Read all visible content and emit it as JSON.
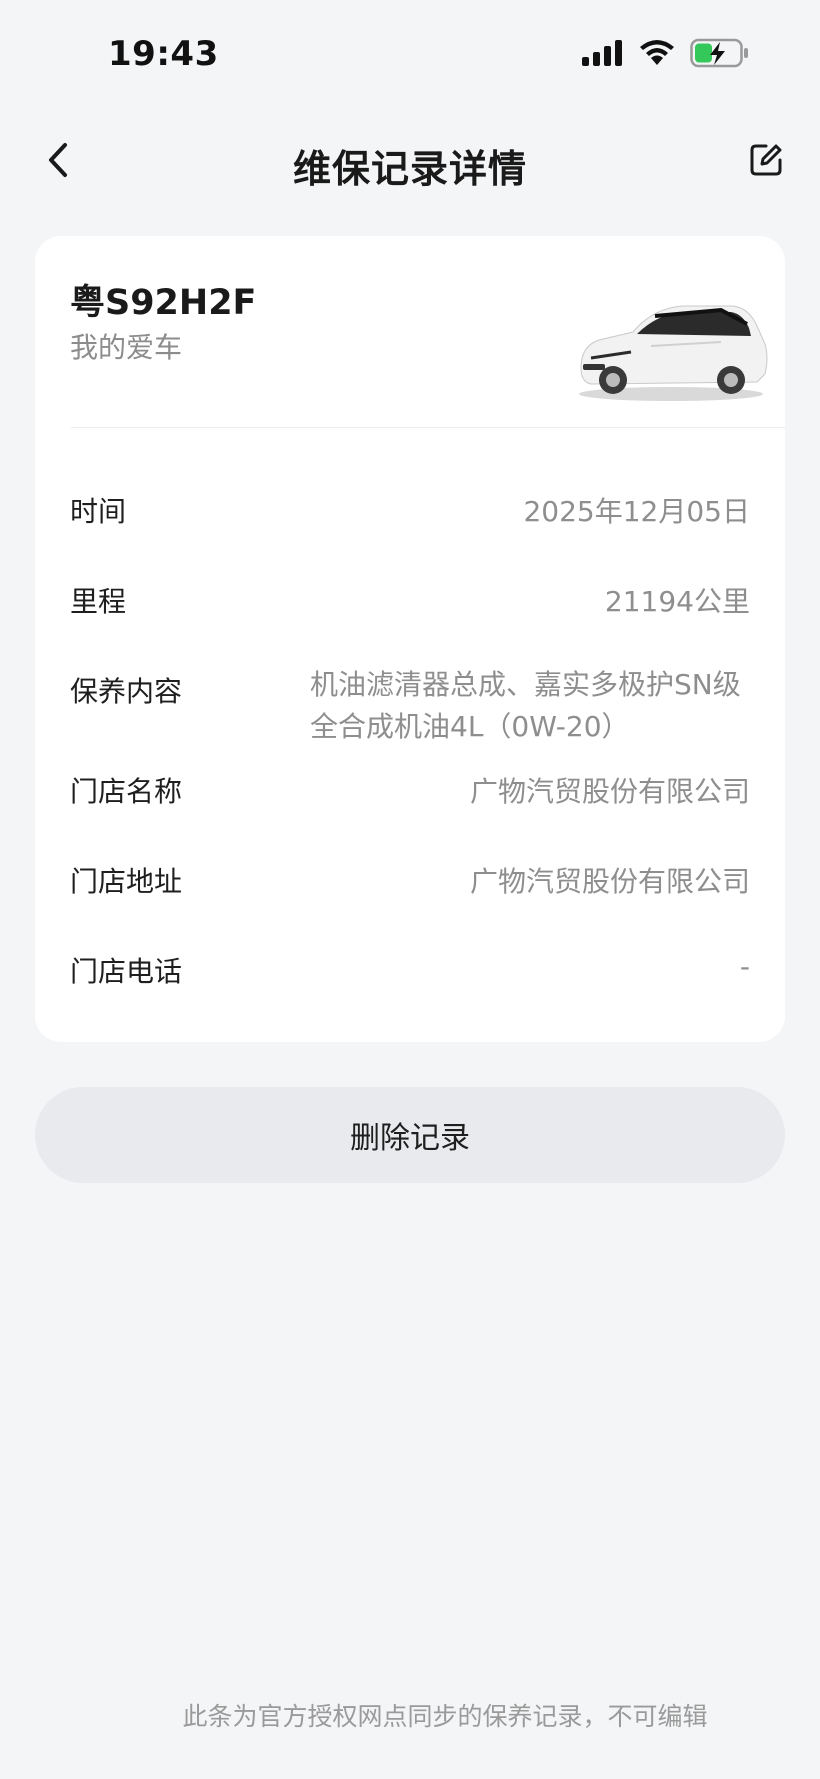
{
  "status_bar": {
    "time": "19:43",
    "icons": [
      "signal-icon",
      "wifi-icon",
      "battery-charging-icon"
    ],
    "battery_color": "#34c759"
  },
  "header": {
    "title": "维保记录详情",
    "back_icon": "chevron-left-icon",
    "edit_icon": "edit-icon"
  },
  "vehicle": {
    "plate": "粤S92H2F",
    "nickname": "我的爱车",
    "image": "white-suv-image"
  },
  "details": [
    {
      "label": "时间",
      "value": "2025年12月05日"
    },
    {
      "label": "里程",
      "value": "21194公里"
    },
    {
      "label": "保养内容",
      "value": "机油滤清器总成、嘉实多极护SN级全合成机油4L（0W-20）"
    },
    {
      "label": "门店名称",
      "value": "广物汽贸股份有限公司"
    },
    {
      "label": "门店地址",
      "value": "广物汽贸股份有限公司"
    },
    {
      "label": "门店电话",
      "value": "-"
    }
  ],
  "actions": {
    "delete_label": "删除记录"
  },
  "footer": {
    "note": "此条为官方授权网点同步的保养记录，不可编辑"
  }
}
